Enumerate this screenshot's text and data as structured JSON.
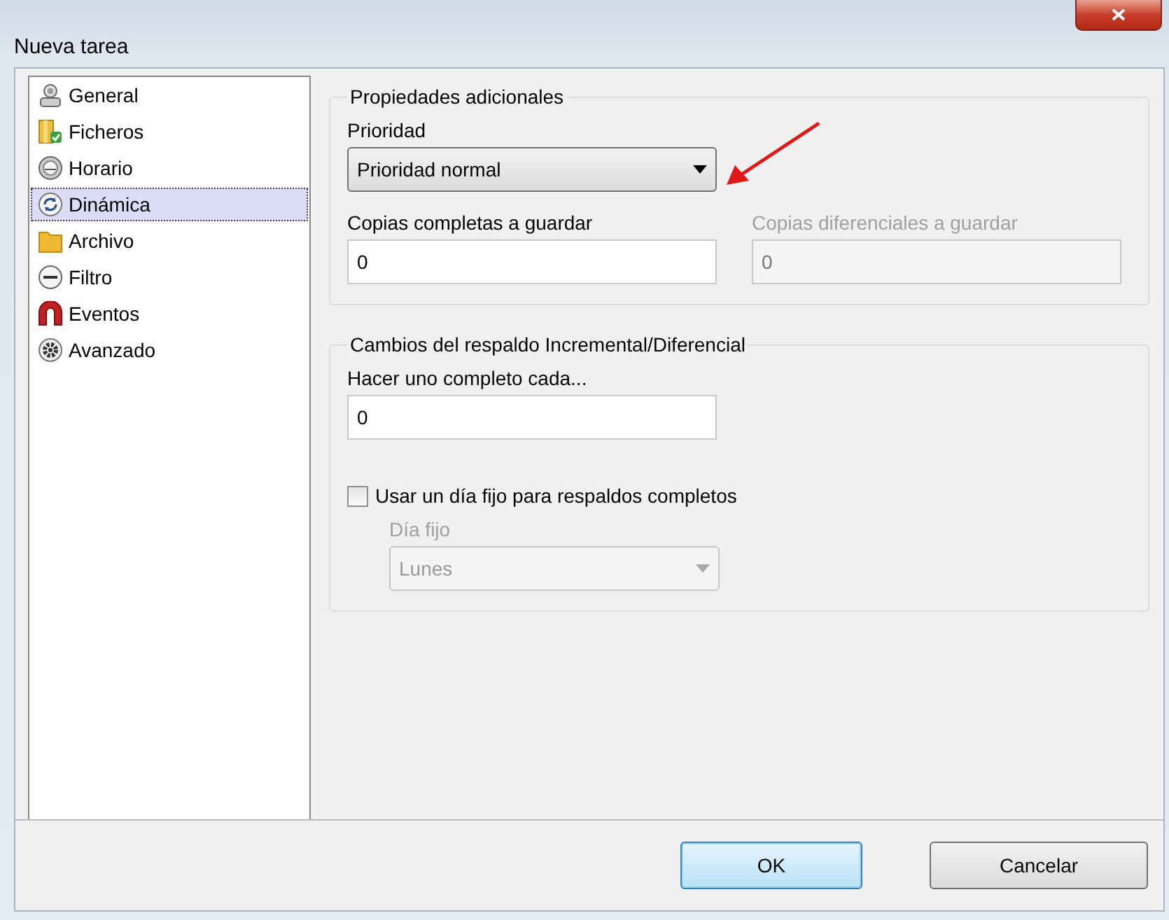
{
  "window": {
    "title": "Nueva tarea"
  },
  "sidebar": {
    "items": [
      {
        "label": "General",
        "selected": false
      },
      {
        "label": "Ficheros",
        "selected": false
      },
      {
        "label": "Horario",
        "selected": false
      },
      {
        "label": "Dinámica",
        "selected": true
      },
      {
        "label": "Archivo",
        "selected": false
      },
      {
        "label": "Filtro",
        "selected": false
      },
      {
        "label": "Eventos",
        "selected": false
      },
      {
        "label": "Avanzado",
        "selected": false
      }
    ]
  },
  "additional_properties": {
    "title": "Propiedades adicionales",
    "priority": {
      "label": "Prioridad",
      "value": "Prioridad normal",
      "disabled": false
    },
    "full_copies": {
      "label": "Copias completas a guardar",
      "value": "0",
      "disabled": false
    },
    "differential_copies": {
      "label": "Copias diferenciales a guardar",
      "value": "0",
      "disabled": true
    }
  },
  "incremental_changes": {
    "title": "Cambios del respaldo Incremental/Diferencial",
    "full_every": {
      "label": "Hacer uno completo cada...",
      "value": "0",
      "disabled": false
    },
    "fixed_day_checkbox": {
      "label": "Usar un día fijo para respaldos completos",
      "checked": false
    },
    "fixed_day": {
      "label": "Día fijo",
      "value": "Lunes",
      "disabled": true
    }
  },
  "buttons": [
    {
      "label": "OK",
      "default": true
    },
    {
      "label": "Cancelar",
      "default": false
    }
  ]
}
